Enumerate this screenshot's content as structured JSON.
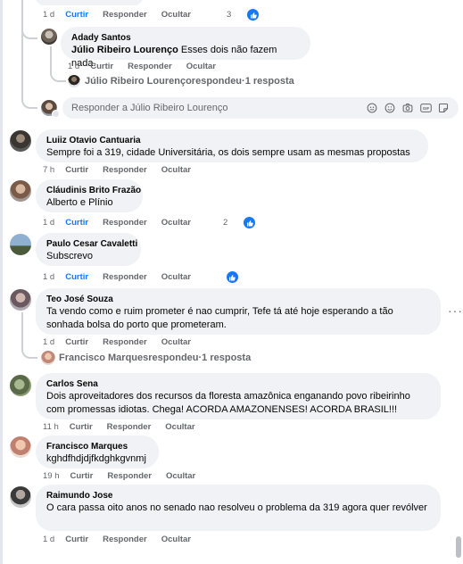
{
  "top_partial": {
    "time": "1 d",
    "like": "Curtir",
    "reply": "Responder",
    "hide": "Ocultar",
    "react_count": "3"
  },
  "adady": {
    "author": "Adady Santos",
    "mention": "Júlio Ribeiro Lourenço",
    "text": " Esses dois não fazem nada.",
    "time": "1 d",
    "like": "Curtir",
    "reply": "Responder",
    "hide": "Ocultar"
  },
  "julio_replied": {
    "name": "Júlio Ribeiro Lourenço",
    "verb": " respondeu",
    "sep": " · ",
    "count": "1 resposta"
  },
  "reply_box": {
    "placeholder": "Responder a Júlio Ribeiro Lourenço"
  },
  "comments": [
    {
      "author": "Luiiz Otavio Cantuaria",
      "text": "Sempre foi a 319, cidade Universitária, os dois sempre usam as mesmas propostas",
      "time": "7 h",
      "like": "Curtir",
      "reply": "Responder",
      "hide": "Ocultar"
    },
    {
      "author": "Cláudinis Brito Frazão",
      "text": "Alberto e Plínio",
      "time": "1 d",
      "like": "Curtir",
      "reply": "Responder",
      "hide": "Ocultar",
      "react_count": "2"
    },
    {
      "author": "Paulo Cesar Cavaletti",
      "text": "Subscrevo",
      "time": "1 d",
      "like": "Curtir",
      "reply": "Responder",
      "hide": "Ocultar"
    },
    {
      "author": "Teo José Souza",
      "text": "Ta vendo como e ruim prometer é nao cumprir, Tefe tá até hoje esperando a tão sonhada bolsa do porto que prometeram.",
      "time": "1 d",
      "like": "Curtir",
      "reply": "Responder",
      "hide": "Ocultar",
      "more": "···"
    },
    {
      "author": "Carlos Sena",
      "text": "Dois aproveitadores dos recursos da floresta amazônica enganando povo ribeirinho com promessas idiotas. Chega! ACORDA AMAZONENSES! ACORDA BRASIL!!!",
      "time": "11 h",
      "like": "Curtir",
      "reply": "Responder",
      "hide": "Ocultar"
    },
    {
      "author": "Francisco Marques",
      "text": "kghdfhdjdjfkdghkgvnmj",
      "time": "19 h",
      "like": "Curtir",
      "reply": "Responder",
      "hide": "Ocultar"
    },
    {
      "author": "Raimundo Jose",
      "text": "O cara passa oito anos no senado nao resolveu o problema da 319 agora quer revólver",
      "time": "1 d",
      "like": "Curtir",
      "reply": "Responder",
      "hide": "Ocultar"
    }
  ],
  "francisco_replied": {
    "name": "Francisco Marques",
    "verb": " respondeu",
    "sep": " · ",
    "count": "1 resposta"
  },
  "colors": {
    "like_blue": "#1877f2",
    "bubble": "#f0f2f5",
    "muted": "#65676b",
    "thread": "#ced0d4"
  },
  "icons": [
    "like-icon",
    "emoji-icon",
    "camera-icon",
    "gif-icon",
    "sticker-icon",
    "more-icon"
  ]
}
